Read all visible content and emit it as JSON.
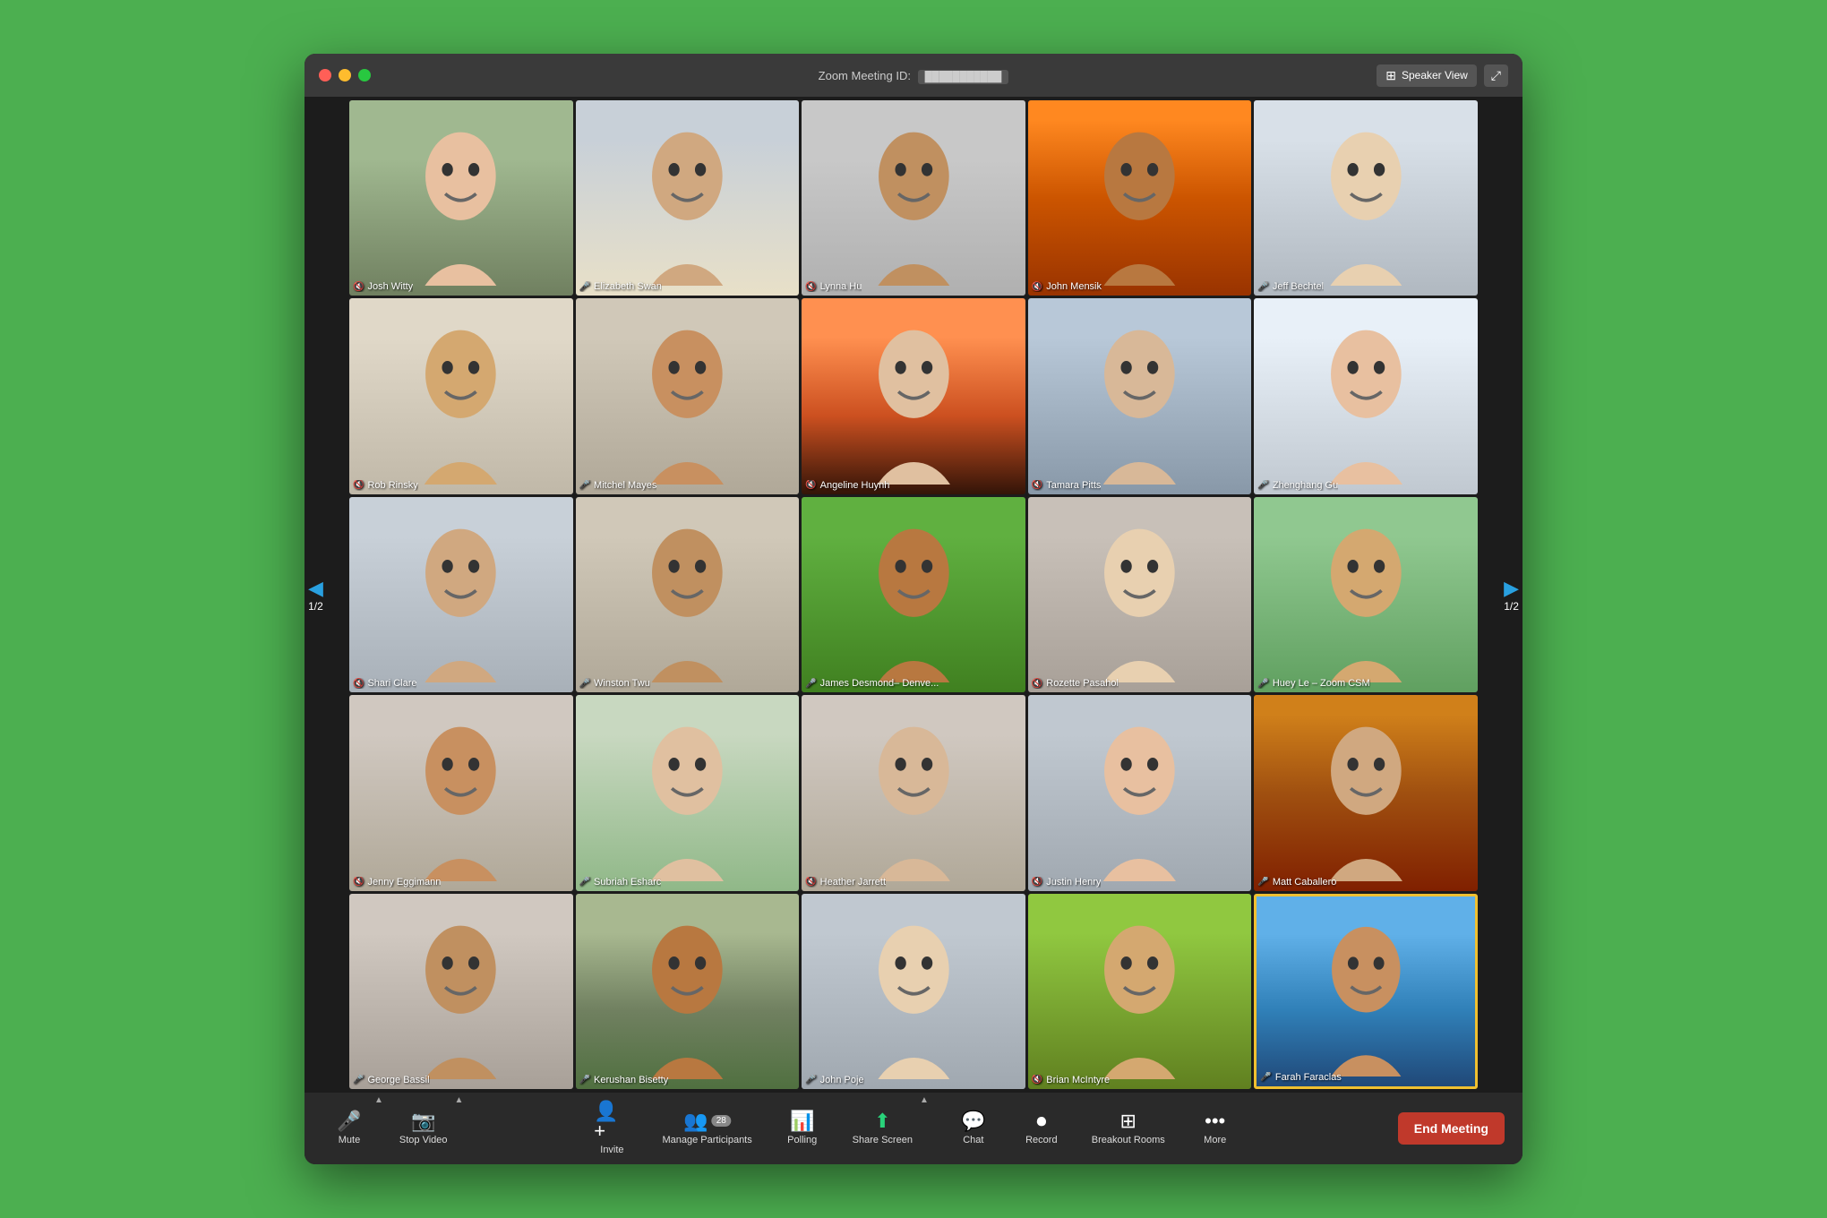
{
  "window": {
    "title": "Zoom Meeting ID:",
    "meeting_id": "███████████"
  },
  "titlebar": {
    "speaker_view_label": "Speaker View",
    "close_label": "●",
    "min_label": "●",
    "max_label": "●"
  },
  "navigation": {
    "left_page": "1/2",
    "right_page": "1/2"
  },
  "participants": [
    {
      "id": 1,
      "name": "Josh Witty",
      "muted": true,
      "scene": "scene-josh",
      "active": false
    },
    {
      "id": 2,
      "name": "Elizabeth Swan",
      "muted": false,
      "scene": "scene-elizabeth",
      "active": false
    },
    {
      "id": 3,
      "name": "Lynna Hu",
      "muted": true,
      "scene": "scene-lynna",
      "active": false
    },
    {
      "id": 4,
      "name": "John Mensik",
      "muted": true,
      "scene": "scene-john",
      "active": false
    },
    {
      "id": 5,
      "name": "Jeff Bechtel",
      "muted": false,
      "scene": "scene-jeff",
      "active": false
    },
    {
      "id": 6,
      "name": "Rob Rinsky",
      "muted": true,
      "scene": "scene-rob",
      "active": false
    },
    {
      "id": 7,
      "name": "Mitchel Mayes",
      "muted": false,
      "scene": "scene-mitchel",
      "active": false
    },
    {
      "id": 8,
      "name": "Angeline Huynh",
      "muted": true,
      "scene": "scene-angeline",
      "active": false
    },
    {
      "id": 9,
      "name": "Tamara Pitts",
      "muted": true,
      "scene": "scene-tamara",
      "active": false
    },
    {
      "id": 10,
      "name": "Zhenghang Gu",
      "muted": false,
      "scene": "scene-zhenghang",
      "active": false
    },
    {
      "id": 11,
      "name": "Shari Clare",
      "muted": true,
      "scene": "scene-shari",
      "active": false
    },
    {
      "id": 12,
      "name": "Winston Twu",
      "muted": false,
      "scene": "scene-winston",
      "active": false
    },
    {
      "id": 13,
      "name": "James Desmond– Denve...",
      "muted": false,
      "scene": "scene-james",
      "active": false
    },
    {
      "id": 14,
      "name": "Rozette Pasahol",
      "muted": true,
      "scene": "scene-rozette",
      "active": false
    },
    {
      "id": 15,
      "name": "Huey Le – Zoom CSM",
      "muted": false,
      "scene": "scene-huey",
      "active": false
    },
    {
      "id": 16,
      "name": "Jenny Eggimann",
      "muted": true,
      "scene": "scene-jenny",
      "active": false
    },
    {
      "id": 17,
      "name": "Subriah Esharc",
      "muted": false,
      "scene": "scene-subriah",
      "active": false
    },
    {
      "id": 18,
      "name": "Heather Jarrett",
      "muted": true,
      "scene": "scene-heather",
      "active": false
    },
    {
      "id": 19,
      "name": "Justin Henry",
      "muted": true,
      "scene": "scene-justin",
      "active": false
    },
    {
      "id": 20,
      "name": "Matt Caballero",
      "muted": false,
      "scene": "scene-matt",
      "active": false
    },
    {
      "id": 21,
      "name": "George Bassil",
      "muted": false,
      "scene": "scene-george",
      "active": false
    },
    {
      "id": 22,
      "name": "Kerushan Bisetty",
      "muted": false,
      "scene": "scene-kerushan",
      "active": false
    },
    {
      "id": 23,
      "name": "John Poje",
      "muted": false,
      "scene": "scene-john-poje",
      "active": false
    },
    {
      "id": 24,
      "name": "Brian McIntyre",
      "muted": true,
      "scene": "scene-brian",
      "active": false
    },
    {
      "id": 25,
      "name": "Farah Faraclas",
      "muted": false,
      "scene": "scene-farah",
      "active": true
    }
  ],
  "toolbar": {
    "mute_label": "Mute",
    "stop_video_label": "Stop Video",
    "invite_label": "Invite",
    "manage_participants_label": "Manage Participants",
    "participants_count": "28",
    "polling_label": "Polling",
    "share_screen_label": "Share Screen",
    "chat_label": "Chat",
    "record_label": "Record",
    "breakout_rooms_label": "Breakout Rooms",
    "more_label": "More",
    "end_meeting_label": "End Meeting"
  }
}
